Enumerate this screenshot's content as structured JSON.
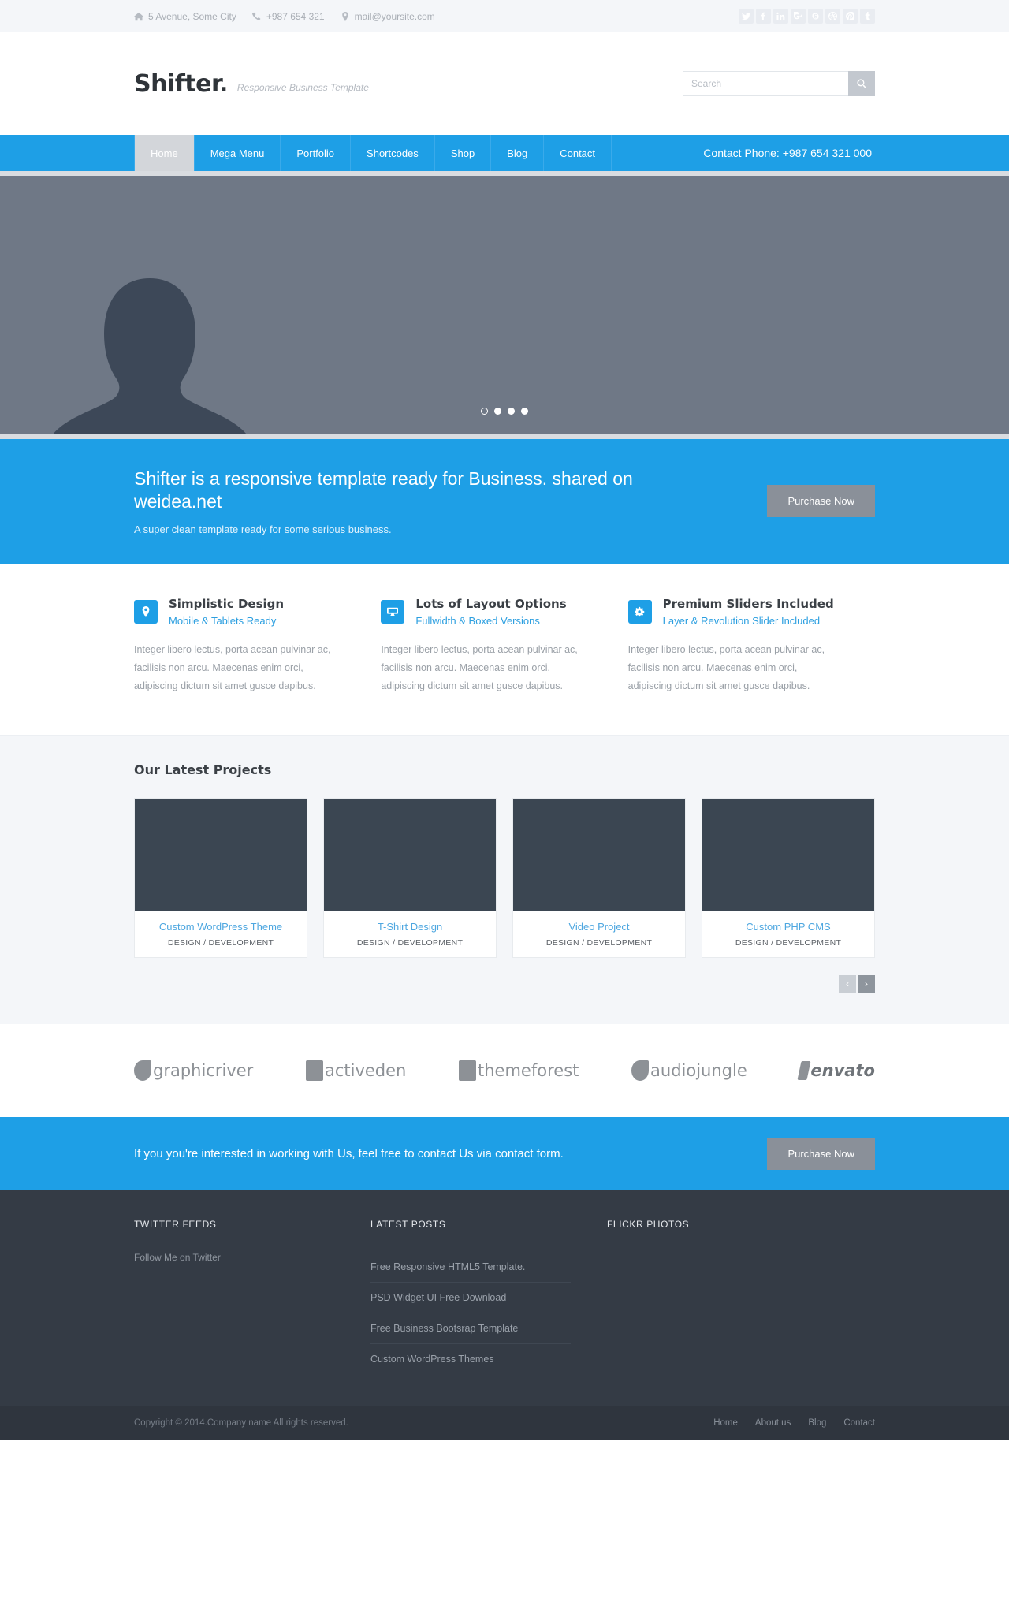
{
  "topbar": {
    "contacts": [
      {
        "icon": "home-icon",
        "text": "5 Avenue, Some City"
      },
      {
        "icon": "phone-icon",
        "text": "+987 654 321"
      },
      {
        "icon": "map-pin-icon",
        "text": "mail@yoursite.com"
      }
    ],
    "social": [
      {
        "name": "twitter-icon",
        "glyph": "t"
      },
      {
        "name": "facebook-icon",
        "glyph": "f"
      },
      {
        "name": "linkedin-icon",
        "glyph": "in"
      },
      {
        "name": "google-plus-icon",
        "glyph": "g+"
      },
      {
        "name": "skype-icon",
        "glyph": "s"
      },
      {
        "name": "dribbble-icon",
        "glyph": "d"
      },
      {
        "name": "pinterest-icon",
        "glyph": "p"
      },
      {
        "name": "tumblr-icon",
        "glyph": "t"
      }
    ]
  },
  "header": {
    "logo": "Shifter.",
    "tagline": "Responsive Business Template",
    "search_placeholder": "Search",
    "search_value": ""
  },
  "nav": {
    "items": [
      {
        "label": "Home",
        "active": true
      },
      {
        "label": "Mega Menu",
        "active": false
      },
      {
        "label": "Portfolio",
        "active": false
      },
      {
        "label": "Shortcodes",
        "active": false
      },
      {
        "label": "Shop",
        "active": false
      },
      {
        "label": "Blog",
        "active": false
      },
      {
        "label": "Contact",
        "active": false
      }
    ],
    "phone": "Contact Phone: +987 654 321 000"
  },
  "slider": {
    "slide_count": 4,
    "active_slide": 1
  },
  "cta_top": {
    "headline": "Shifter is a responsive template ready for Business. shared on weidea.net",
    "subline": "A super clean template ready for some serious business.",
    "button": "Purchase Now"
  },
  "features": [
    {
      "icon": "map-pin-icon",
      "title": "Simplistic Design",
      "subtitle": "Mobile & Tablets Ready",
      "body": "Integer libero lectus, porta acean pulvinar ac, facilisis non arcu. Maecenas enim orci, adipiscing dictum sit amet gusce dapibus."
    },
    {
      "icon": "monitor-icon",
      "title": "Lots of Layout Options",
      "subtitle": "Fullwidth & Boxed Versions",
      "body": "Integer libero lectus, porta acean pulvinar ac, facilisis non arcu. Maecenas enim orci, adipiscing dictum sit amet gusce dapibus."
    },
    {
      "icon": "gear-icon",
      "title": "Premium Sliders Included",
      "subtitle": "Layer & Revolution Slider Included",
      "body": "Integer libero lectus, porta acean pulvinar ac, facilisis non arcu. Maecenas enim orci, adipiscing dictum sit amet gusce dapibus."
    }
  ],
  "projects": {
    "title": "Our Latest Projects",
    "items": [
      {
        "title": "Custom WordPress Theme",
        "meta": "DESIGN / DEVELOPMENT"
      },
      {
        "title": "T-Shirt Design",
        "meta": "DESIGN / DEVELOPMENT"
      },
      {
        "title": "Video Project",
        "meta": "DESIGN / DEVELOPMENT"
      },
      {
        "title": "Custom PHP CMS",
        "meta": "DESIGN / DEVELOPMENT"
      }
    ],
    "prev_label": "‹",
    "next_label": "›"
  },
  "clients": [
    {
      "name": "graphicriver"
    },
    {
      "name": "activeden"
    },
    {
      "name": "themeforest"
    },
    {
      "name": "audiojungle"
    },
    {
      "name": "envato"
    }
  ],
  "cta_bottom": {
    "text": "If you you're interested in working with Us, feel free to contact Us via contact form.",
    "button": "Purchase Now"
  },
  "footer": {
    "twitter": {
      "title": "TWITTER FEEDS",
      "text": "Follow Me on Twitter"
    },
    "posts": {
      "title": "LATEST POSTS",
      "items": [
        "Free Responsive HTML5 Template.",
        "PSD Widget UI Free Download",
        "Free Business Bootsrap Template",
        "Custom WordPress Themes"
      ]
    },
    "flickr": {
      "title": "FLICKR PHOTOS"
    },
    "copyright": "Copyright © 2014.Company name All rights reserved.",
    "links": [
      "Home",
      "About us",
      "Blog",
      "Contact"
    ]
  },
  "colors": {
    "accent": "#1e9fe6",
    "dark": "#343b45",
    "slider_bg": "#6f7886"
  }
}
